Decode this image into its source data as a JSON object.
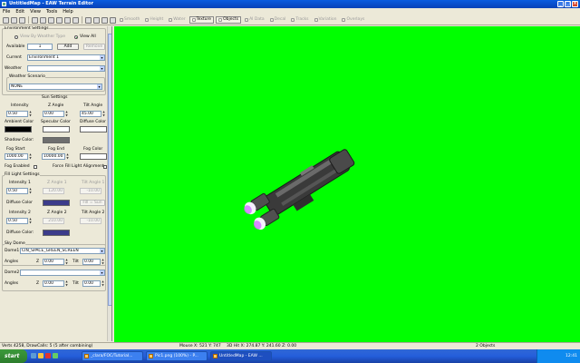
{
  "window": {
    "title": "UntitledMap - EAW Terrain Editor"
  },
  "menu": [
    "File",
    "Edit",
    "View",
    "Tools",
    "Help"
  ],
  "toolbar": {
    "tools": [
      "Smooth",
      "Height",
      "Water",
      "Texture",
      "Objects",
      "AI Data",
      "Decal",
      "Tracks",
      "Variation",
      "Overlays"
    ]
  },
  "panel": {
    "env_settings": {
      "title": "Environment Settings",
      "radio_weather_type": "View By Weather Type",
      "radio_view_all": "View All",
      "available_label": "Available",
      "available_value": "1",
      "add_label": "Add",
      "remove_label": "Remove",
      "current_label": "Current",
      "current_value": "Environment 1",
      "weather_label": "Weather",
      "weather_value": "",
      "weather_scenario_title": "Weather Scenario",
      "weather_scenario_value": "NONE"
    },
    "sun": {
      "title": "Sun Settings",
      "intensity_label": "Intensity",
      "z_angle_label": "Z Angle",
      "tilt_angle_label": "Tilt Angle",
      "intensity": "0.50",
      "z_angle": "0.00",
      "tilt_angle": "45.00",
      "ambient_label": "Ambient Color",
      "specular_label": "Specular Color",
      "diffuse_label": "Diffuse Color",
      "ambient_color": "#000000",
      "specular_color": "#ffffff",
      "diffuse_color": "#ffffff",
      "shadow_label": "Shadow Color:",
      "shadow_color": "#6e6e6e",
      "fog_start_label": "Fog Start",
      "fog_end_label": "Fog End",
      "fog_color_label": "Fog Color",
      "fog_start": "1000.00",
      "fog_end": "10000.00",
      "fog_color": "#ffffff",
      "fog_enabled_label": "Fog Enabled",
      "force_fill_label": "Force Fill Light Alignment"
    },
    "fill": {
      "title": "Fill Light Settings",
      "intensity1_label": "Intensity 1",
      "z_angle1_label": "Z Angle 1",
      "tilt_angle1_label": "Tilt Angle 1",
      "intensity1": "0.50",
      "z_angle1": "120.00",
      "tilt_angle1": "-10.00",
      "diffuse_label": "Diffuse Color",
      "diffuse_color1": "#3b3b8a",
      "fill_sun_label": "Fill = Sun",
      "intensity2_label": "Intensity 2",
      "z_angle2_label": "Z Angle 2",
      "tilt_angle2_label": "Tilt Angle 2",
      "intensity2": "0.50",
      "z_angle2": "210.00",
      "tilt_angle2": "-10.00",
      "diffuse2_label": "Diffuse Color:",
      "diffuse_color2": "#3b3b8a"
    },
    "sky": {
      "title": "Sky Dome",
      "dome1_label": "Dome1",
      "dome1_value": "CIN_SPACE_GREEN_SCREEN",
      "angles_label": "Angles",
      "dome1_z_label": "Z",
      "dome1_z": "0.00",
      "dome1_tilt_label": "Tilt",
      "dome1_tilt": "0.00",
      "dome2_label": "Dome2",
      "dome2_value": "",
      "dome2_z_label": "Z",
      "dome2_z": "0.00",
      "dome2_tilt_label": "Tilt",
      "dome2_tilt": "0.00"
    }
  },
  "viewport": {
    "background_color": "#00ff00"
  },
  "status": {
    "verts": "Verts 4258, DrawCalls: 5 (5 after combining)",
    "mouse": "Mouse X: 521 Y: 747",
    "hit": "3D Hit X: 274.87 Y: 241.60 Z: 0.00",
    "objects": "2 Objects"
  },
  "taskbar": {
    "start_label": "start",
    "tasks": [
      "_clara/FOC/Tutorial...",
      "Pic1.png (100%) - P...",
      "UntitledMap - EAW ..."
    ],
    "clock": "12:41"
  }
}
